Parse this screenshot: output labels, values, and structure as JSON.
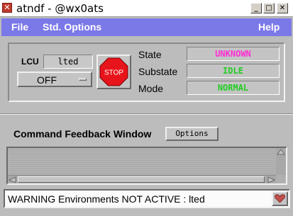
{
  "window": {
    "title": "atndf - @wx0ats",
    "icon": "x-window-icon",
    "minimize_label": "_",
    "maximize_label": "□",
    "close_label": "✕"
  },
  "menu": {
    "file": "File",
    "std_options": "Std. Options",
    "help": "Help"
  },
  "lcu": {
    "label": "LCU",
    "name": "lted",
    "mode_selected": "OFF",
    "stop_label": "STOP"
  },
  "status": {
    "state_label": "State",
    "state_value": "UNKNOWN",
    "substate_label": "Substate",
    "substate_value": "IDLE",
    "mode_label": "Mode",
    "mode_value": "NORMAL"
  },
  "feedback": {
    "title": "Command Feedback Window",
    "options_label": "Options"
  },
  "statusbar": {
    "message": "WARNING Environments NOT ACTIVE : lted",
    "icon": "heart-icon"
  },
  "colors": {
    "menubar": "#7b78e8",
    "unknown": "#ff2bd6",
    "ok": "#22cc22",
    "stop_red": "#e8141b"
  }
}
